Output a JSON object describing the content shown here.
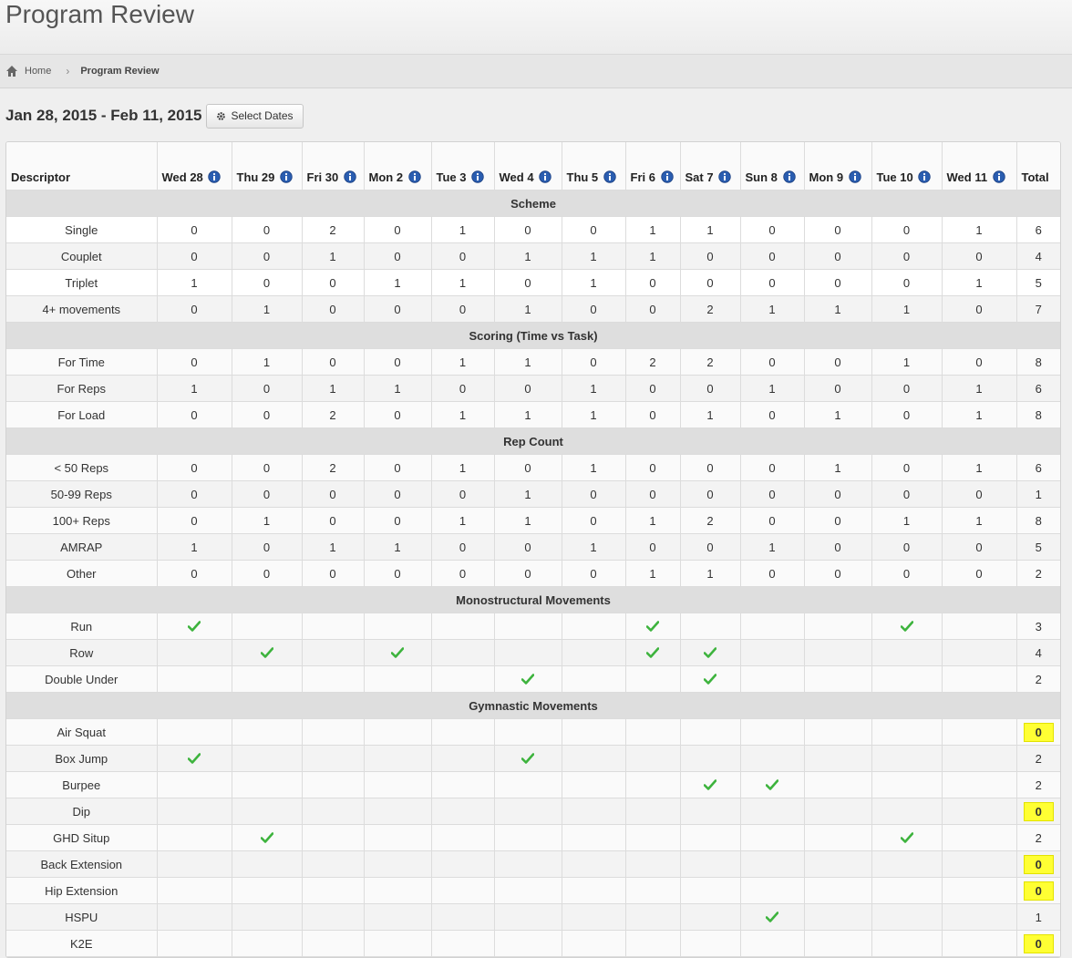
{
  "page": {
    "title": "Program Review"
  },
  "breadcrumb": {
    "home": "Home",
    "current": "Program Review"
  },
  "range": {
    "title": "Jan 28, 2015 - Feb 11, 2015",
    "select_label": "Select Dates"
  },
  "table": {
    "descriptor_header": "Descriptor",
    "total_header": "Total",
    "days": [
      "Wed 28",
      "Thu 29",
      "Fri 30",
      "Mon 2",
      "Tue 3",
      "Wed 4",
      "Thu 5",
      "Fri 6",
      "Sat 7",
      "Sun 8",
      "Mon 9",
      "Tue 10",
      "Wed 11"
    ],
    "sections": [
      {
        "name": "Scheme",
        "kind": "count",
        "rows": [
          {
            "label": "Single",
            "values": [
              0,
              0,
              2,
              0,
              1,
              0,
              0,
              1,
              1,
              0,
              0,
              0,
              1
            ],
            "total": 6
          },
          {
            "label": "Couplet",
            "values": [
              0,
              0,
              1,
              0,
              0,
              1,
              1,
              1,
              0,
              0,
              0,
              0,
              0
            ],
            "total": 4
          },
          {
            "label": "Triplet",
            "values": [
              1,
              0,
              0,
              1,
              1,
              0,
              1,
              0,
              0,
              0,
              0,
              0,
              1
            ],
            "total": 5
          },
          {
            "label": "4+ movements",
            "values": [
              0,
              1,
              0,
              0,
              0,
              1,
              0,
              0,
              2,
              1,
              1,
              1,
              0
            ],
            "total": 7
          }
        ]
      },
      {
        "name": "Scoring (Time vs Task)",
        "kind": "count",
        "rows": [
          {
            "label": "For Time",
            "values": [
              0,
              1,
              0,
              0,
              1,
              1,
              0,
              2,
              2,
              0,
              0,
              1,
              0
            ],
            "total": 8
          },
          {
            "label": "For Reps",
            "values": [
              1,
              0,
              1,
              1,
              0,
              0,
              1,
              0,
              0,
              1,
              0,
              0,
              1
            ],
            "total": 6
          },
          {
            "label": "For Load",
            "values": [
              0,
              0,
              2,
              0,
              1,
              1,
              1,
              0,
              1,
              0,
              1,
              0,
              1
            ],
            "total": 8
          }
        ]
      },
      {
        "name": "Rep Count",
        "kind": "count",
        "rows": [
          {
            "label": "< 50 Reps",
            "values": [
              0,
              0,
              2,
              0,
              1,
              0,
              1,
              0,
              0,
              0,
              1,
              0,
              1
            ],
            "total": 6
          },
          {
            "label": "50-99 Reps",
            "values": [
              0,
              0,
              0,
              0,
              0,
              1,
              0,
              0,
              0,
              0,
              0,
              0,
              0
            ],
            "total": 1
          },
          {
            "label": "100+ Reps",
            "values": [
              0,
              1,
              0,
              0,
              1,
              1,
              0,
              1,
              2,
              0,
              0,
              1,
              1
            ],
            "total": 8
          },
          {
            "label": "AMRAP",
            "values": [
              1,
              0,
              1,
              1,
              0,
              0,
              1,
              0,
              0,
              1,
              0,
              0,
              0
            ],
            "total": 5
          },
          {
            "label": "Other",
            "values": [
              0,
              0,
              0,
              0,
              0,
              0,
              0,
              1,
              1,
              0,
              0,
              0,
              0
            ],
            "total": 2
          }
        ]
      },
      {
        "name": "Monostructural Movements",
        "kind": "check",
        "rows": [
          {
            "label": "Run",
            "values": [
              1,
              0,
              0,
              0,
              0,
              0,
              0,
              1,
              0,
              0,
              0,
              1,
              0
            ],
            "total": 3
          },
          {
            "label": "Row",
            "values": [
              0,
              1,
              0,
              1,
              0,
              0,
              0,
              1,
              1,
              0,
              0,
              0,
              0
            ],
            "total": 4
          },
          {
            "label": "Double Under",
            "values": [
              0,
              0,
              0,
              0,
              0,
              1,
              0,
              0,
              1,
              0,
              0,
              0,
              0
            ],
            "total": 2
          }
        ]
      },
      {
        "name": "Gymnastic Movements",
        "kind": "check",
        "rows": [
          {
            "label": "Air Squat",
            "values": [
              0,
              0,
              0,
              0,
              0,
              0,
              0,
              0,
              0,
              0,
              0,
              0,
              0
            ],
            "total": 0
          },
          {
            "label": "Box Jump",
            "values": [
              1,
              0,
              0,
              0,
              0,
              1,
              0,
              0,
              0,
              0,
              0,
              0,
              0
            ],
            "total": 2
          },
          {
            "label": "Burpee",
            "values": [
              0,
              0,
              0,
              0,
              0,
              0,
              0,
              0,
              1,
              1,
              0,
              0,
              0
            ],
            "total": 2
          },
          {
            "label": "Dip",
            "values": [
              0,
              0,
              0,
              0,
              0,
              0,
              0,
              0,
              0,
              0,
              0,
              0,
              0
            ],
            "total": 0
          },
          {
            "label": "GHD Situp",
            "values": [
              0,
              1,
              0,
              0,
              0,
              0,
              0,
              0,
              0,
              0,
              0,
              1,
              0
            ],
            "total": 2
          },
          {
            "label": "Back Extension",
            "values": [
              0,
              0,
              0,
              0,
              0,
              0,
              0,
              0,
              0,
              0,
              0,
              0,
              0
            ],
            "total": 0
          },
          {
            "label": "Hip Extension",
            "values": [
              0,
              0,
              0,
              0,
              0,
              0,
              0,
              0,
              0,
              0,
              0,
              0,
              0
            ],
            "total": 0
          },
          {
            "label": "HSPU",
            "values": [
              0,
              0,
              0,
              0,
              0,
              0,
              0,
              0,
              0,
              1,
              0,
              0,
              0
            ],
            "total": 1
          },
          {
            "label": "K2E",
            "values": [
              0,
              0,
              0,
              0,
              0,
              0,
              0,
              0,
              0,
              0,
              0,
              0,
              0
            ],
            "total": 0
          }
        ]
      }
    ]
  },
  "colors": {
    "zero_highlight": "#ffff33",
    "check": "#3db33d",
    "info": "#2a5db0",
    "section_bg": "#dedede"
  },
  "icons": {
    "home": "home-icon",
    "gear": "gear-icon",
    "info": "info-icon",
    "check": "checkmark-icon"
  }
}
